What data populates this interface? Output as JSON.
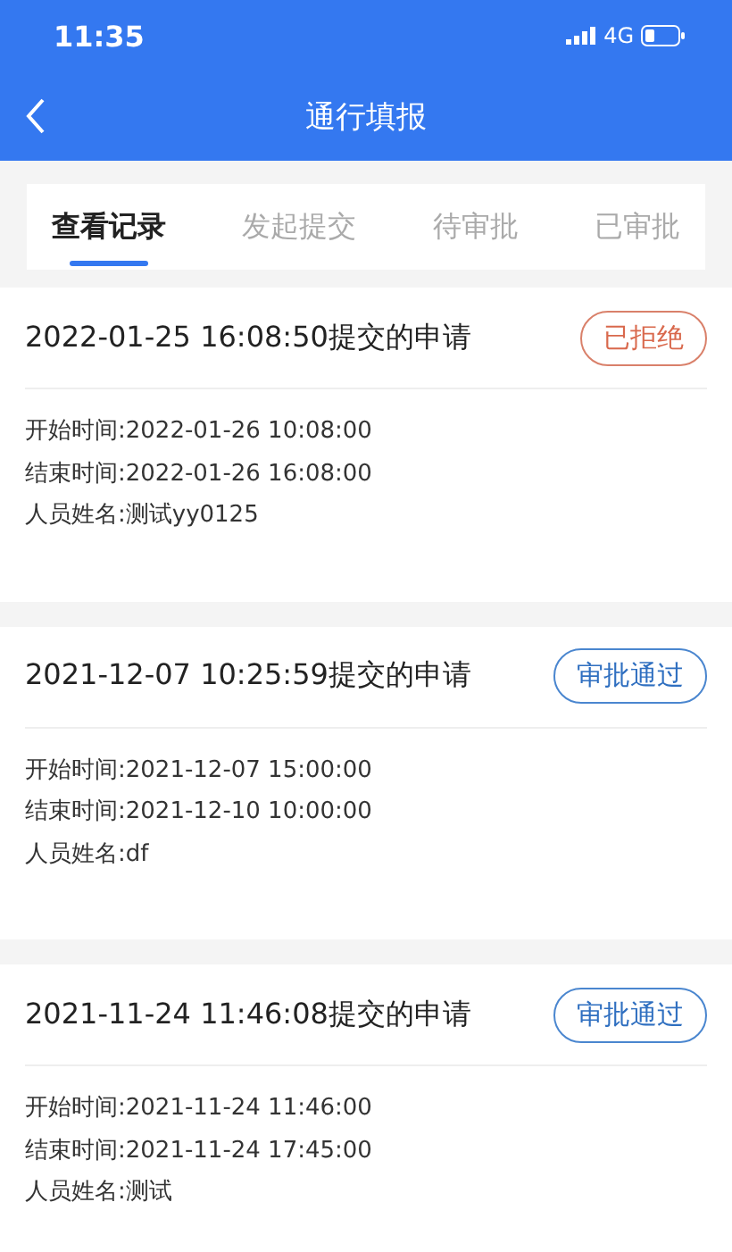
{
  "status_bar": {
    "time": "11:35",
    "network": "4G"
  },
  "header": {
    "title": "通行填报"
  },
  "tabs": [
    {
      "label": "查看记录",
      "selected": true
    },
    {
      "label": "发起提交",
      "selected": false
    },
    {
      "label": "待审批",
      "selected": false
    },
    {
      "label": "已审批",
      "selected": false
    }
  ],
  "records": [
    {
      "title": "2022-01-25 16:08:50提交的申请",
      "status": {
        "label": "已拒绝",
        "kind": "rejected"
      },
      "lines": [
        "开始时间:2022-01-26 10:08:00",
        "结束时间:2022-01-26 16:08:00",
        "人员姓名:测试yy0125"
      ]
    },
    {
      "title": "2021-12-07 10:25:59提交的申请",
      "status": {
        "label": "审批通过",
        "kind": "approved"
      },
      "lines": [
        "开始时间:2021-12-07 15:00:00",
        "结束时间:2021-12-10 10:00:00",
        "人员姓名:df"
      ]
    },
    {
      "title": "2021-11-24 11:46:08提交的申请",
      "status": {
        "label": "审批通过",
        "kind": "approved"
      },
      "lines": [
        "开始时间:2021-11-24 11:46:00",
        "结束时间:2021-11-24 17:45:00",
        "人员姓名:测试"
      ]
    }
  ]
}
